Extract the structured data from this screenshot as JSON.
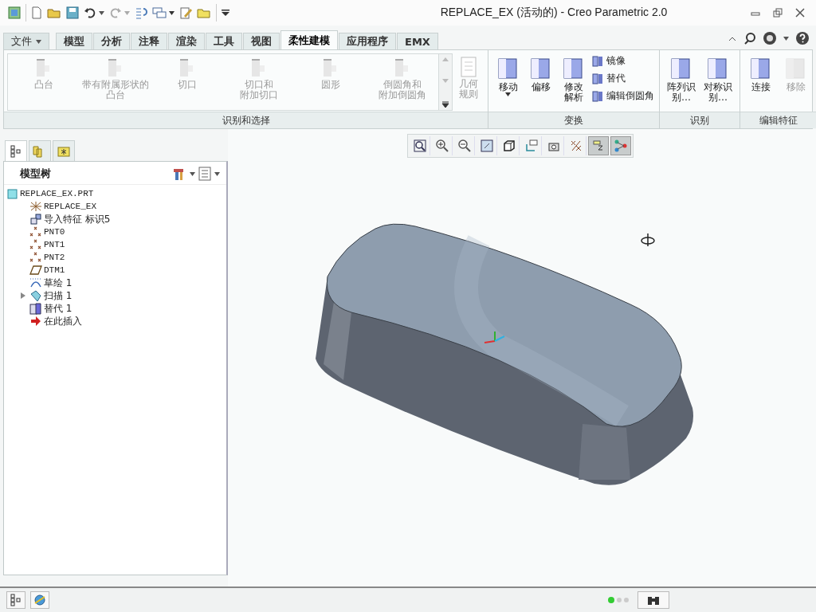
{
  "window": {
    "title": "REPLACE_EX (活动的) - Creo Parametric 2.0"
  },
  "tabs": [
    {
      "label": "文件",
      "selected": false,
      "kind": "menu"
    },
    {
      "label": "模型",
      "selected": false,
      "kind": "tab"
    },
    {
      "label": "分析",
      "selected": false,
      "kind": "tab"
    },
    {
      "label": "注释",
      "selected": false,
      "kind": "tab"
    },
    {
      "label": "渲染",
      "selected": false,
      "kind": "tab"
    },
    {
      "label": "工具",
      "selected": false,
      "kind": "tab"
    },
    {
      "label": "视图",
      "selected": false,
      "kind": "tab"
    },
    {
      "label": "柔性建模",
      "selected": true,
      "kind": "tab"
    },
    {
      "label": "应用程序",
      "selected": false,
      "kind": "tab"
    },
    {
      "label": "EMX",
      "selected": false,
      "kind": "tab"
    }
  ],
  "ribbon_groups": [
    {
      "label": "识别和选择",
      "kind": "gallery",
      "buttons": [
        {
          "label": [
            "凸台"
          ],
          "disabled": true
        },
        {
          "label": [
            "带有附属形状的",
            "凸台"
          ],
          "disabled": true
        },
        {
          "label": [
            "切口"
          ],
          "disabled": true
        },
        {
          "label": [
            "切口和",
            "附加切口"
          ],
          "disabled": true
        },
        {
          "label": [
            "圆形"
          ],
          "disabled": true
        },
        {
          "label": [
            "倒圆角和",
            "附加倒圆角"
          ],
          "disabled": true
        },
        {
          "label": [
            "几何",
            "规则"
          ],
          "disabled": true
        }
      ]
    },
    {
      "label": "变换",
      "kind": "mixed",
      "buttons": [
        {
          "label": [
            "移动"
          ],
          "disabled": false,
          "dropdown": true
        },
        {
          "label": [
            "偏移"
          ],
          "disabled": false,
          "dropdown": false
        },
        {
          "label": [
            "修改",
            "解析"
          ],
          "disabled": false,
          "dropdown": false
        }
      ],
      "small_buttons": [
        {
          "label": "镜像",
          "disabled": false
        },
        {
          "label": "替代",
          "disabled": false
        },
        {
          "label": "编辑倒圆角",
          "disabled": false
        }
      ]
    },
    {
      "label": "识别",
      "kind": "large",
      "buttons": [
        {
          "label": [
            "阵列识",
            "别…"
          ],
          "disabled": false
        },
        {
          "label": [
            "对称识",
            "别…"
          ],
          "disabled": false
        }
      ]
    },
    {
      "label": "编辑特征",
      "kind": "large",
      "buttons": [
        {
          "label": [
            "连接"
          ],
          "disabled": false
        },
        {
          "label": [
            "移除"
          ],
          "disabled": true
        }
      ]
    }
  ],
  "model_tree": {
    "title": "模型树",
    "items": [
      {
        "label": "REPLACE_EX.PRT",
        "kind": "part",
        "collapsed": false
      },
      {
        "label": "REPLACE_EX",
        "kind": "csys",
        "collapsed": false
      },
      {
        "label": "导入特征 标识5",
        "kind": "import",
        "collapsed": false
      },
      {
        "label": "PNT0",
        "kind": "point",
        "collapsed": false
      },
      {
        "label": "PNT1",
        "kind": "point",
        "collapsed": false
      },
      {
        "label": "PNT2",
        "kind": "point",
        "collapsed": false
      },
      {
        "label": "DTM1",
        "kind": "plane",
        "collapsed": false
      },
      {
        "label": "草绘 1",
        "kind": "sketch",
        "collapsed": false
      },
      {
        "label": "扫描 1",
        "kind": "sweep",
        "collapsed": true
      },
      {
        "label": "替代 1",
        "kind": "substitute",
        "collapsed": false
      },
      {
        "label": "在此插入",
        "kind": "insert",
        "collapsed": false
      }
    ]
  },
  "view_toolbar": [
    {
      "kind": "refit",
      "selected": false
    },
    {
      "kind": "zoom-in",
      "selected": false
    },
    {
      "kind": "zoom-out",
      "selected": false
    },
    {
      "kind": "repaint",
      "selected": false
    },
    {
      "kind": "display-style",
      "selected": false
    },
    {
      "kind": "saved-views",
      "selected": false
    },
    {
      "kind": "camera",
      "selected": false
    },
    {
      "kind": "datum",
      "selected": false
    },
    {
      "kind": "spin-center",
      "selected": true
    },
    {
      "kind": "annotation",
      "selected": true
    }
  ]
}
